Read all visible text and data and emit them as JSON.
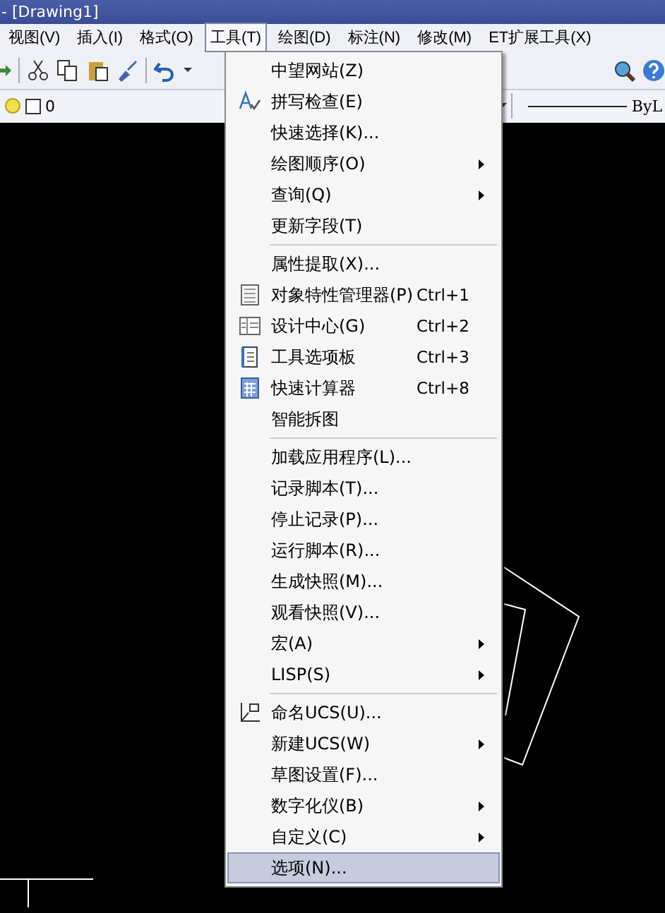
{
  "window": {
    "title": "- [Drawing1]"
  },
  "menubar": [
    {
      "label": "视图(V)",
      "selected": false
    },
    {
      "label": "插入(I)",
      "selected": false
    },
    {
      "label": "格式(O)",
      "selected": false
    },
    {
      "label": "工具(T)",
      "selected": true
    },
    {
      "label": "绘图(D)",
      "selected": false
    },
    {
      "label": "标注(N)",
      "selected": false
    },
    {
      "label": "修改(M)",
      "selected": false
    },
    {
      "label": "ET扩展工具(X)",
      "selected": false
    }
  ],
  "layer_toolbar": {
    "layer": "0",
    "linetype": "ByL"
  },
  "menu": [
    {
      "kind": "item",
      "label": "中望网站(Z)",
      "submenu": false,
      "selected": false
    },
    {
      "kind": "item",
      "label": "拼写检查(E)",
      "submenu": false,
      "selected": false
    },
    {
      "kind": "item",
      "label": "快速选择(K)...",
      "submenu": false,
      "selected": false
    },
    {
      "kind": "item",
      "label": "绘图顺序(O)",
      "submenu": true,
      "selected": false
    },
    {
      "kind": "item",
      "label": "查询(Q)",
      "submenu": true,
      "selected": false
    },
    {
      "kind": "item",
      "label": "更新字段(T)",
      "submenu": false,
      "selected": false
    },
    {
      "kind": "separator"
    },
    {
      "kind": "item",
      "label": "属性提取(X)...",
      "submenu": false,
      "selected": false
    },
    {
      "kind": "item",
      "label": "对象特性管理器(P)",
      "shortcut": "Ctrl+1",
      "submenu": false,
      "selected": false
    },
    {
      "kind": "item",
      "label": "设计中心(G)",
      "shortcut": "Ctrl+2",
      "submenu": false,
      "selected": false
    },
    {
      "kind": "item",
      "label": "工具选项板",
      "shortcut": "Ctrl+3",
      "submenu": false,
      "selected": false
    },
    {
      "kind": "item",
      "label": "快速计算器",
      "shortcut": "Ctrl+8",
      "submenu": false,
      "selected": false
    },
    {
      "kind": "item",
      "label": "智能拆图",
      "submenu": false,
      "selected": false
    },
    {
      "kind": "separator"
    },
    {
      "kind": "item",
      "label": "加载应用程序(L)...",
      "submenu": false,
      "selected": false
    },
    {
      "kind": "item",
      "label": "记录脚本(T)...",
      "submenu": false,
      "selected": false
    },
    {
      "kind": "item",
      "label": "停止记录(P)...",
      "submenu": false,
      "selected": false
    },
    {
      "kind": "item",
      "label": "运行脚本(R)...",
      "submenu": false,
      "selected": false
    },
    {
      "kind": "item",
      "label": "生成快照(M)...",
      "submenu": false,
      "selected": false
    },
    {
      "kind": "item",
      "label": "观看快照(V)...",
      "submenu": false,
      "selected": false
    },
    {
      "kind": "item",
      "label": "宏(A)",
      "submenu": true,
      "selected": false
    },
    {
      "kind": "item",
      "label": "LISP(S)",
      "submenu": true,
      "selected": false
    },
    {
      "kind": "separator"
    },
    {
      "kind": "item",
      "label": "命名UCS(U)...",
      "submenu": false,
      "selected": false
    },
    {
      "kind": "item",
      "label": "新建UCS(W)",
      "submenu": true,
      "selected": false
    },
    {
      "kind": "item",
      "label": "草图设置(F)...",
      "submenu": false,
      "selected": false
    },
    {
      "kind": "item",
      "label": "数字化仪(B)",
      "submenu": true,
      "selected": false
    },
    {
      "kind": "item",
      "label": "自定义(C)",
      "submenu": true,
      "selected": false
    },
    {
      "kind": "item",
      "label": "选项(N)...",
      "submenu": false,
      "selected": true
    }
  ]
}
